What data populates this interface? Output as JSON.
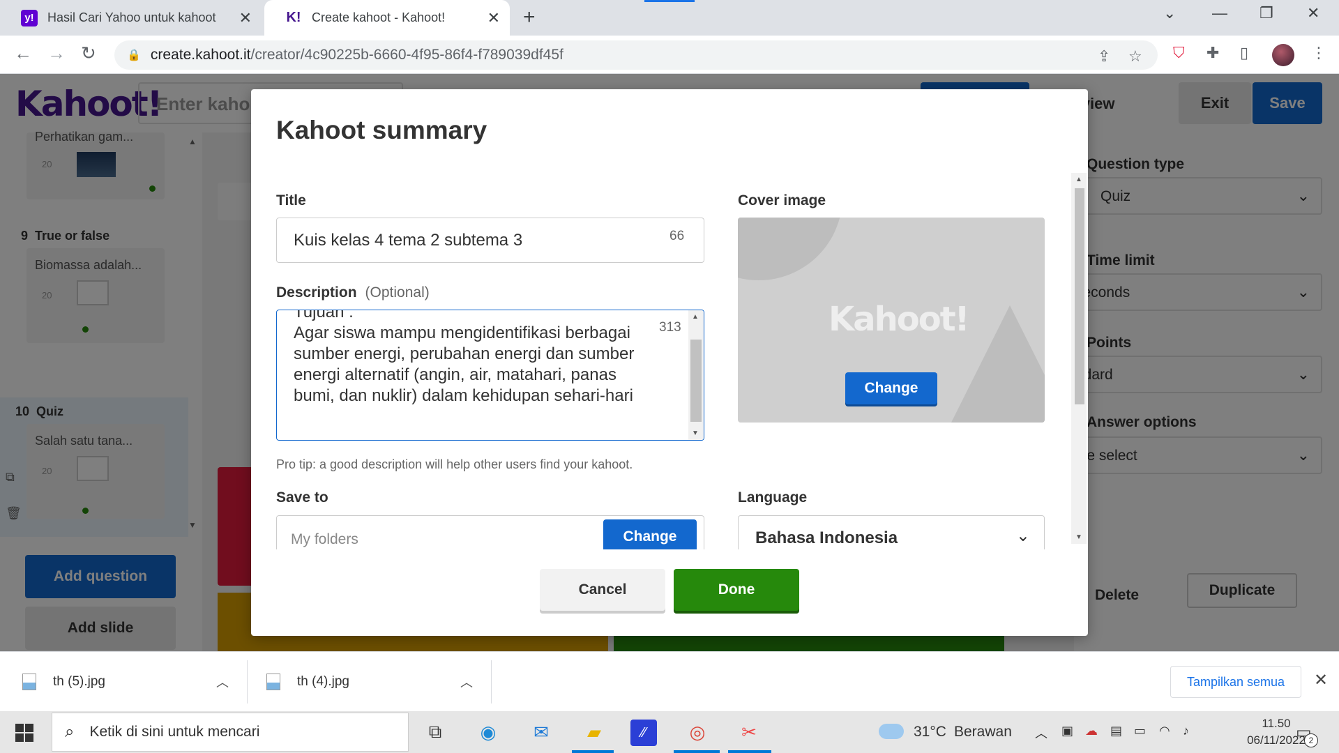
{
  "browser": {
    "tabs": [
      {
        "title": "Hasil Cari Yahoo untuk kahoot",
        "favicon": "y!"
      },
      {
        "title": "Create kahoot - Kahoot!",
        "favicon": "K!"
      }
    ],
    "new_tab": "+",
    "url_domain": "create.kahoot.it",
    "url_path": "/creator/4c90225b-6660-4f95-86f4-f789039df45f"
  },
  "app": {
    "logo": "Kahoot!",
    "title_placeholder": "Enter kaho",
    "preview_label": "review",
    "exit_label": "Exit",
    "save_label": "Save",
    "slides": [
      {
        "title": "Perhatikan gam...",
        "num": "20"
      },
      {
        "label_num": "9",
        "label_type": "True or false",
        "title": "Biomassa adalah...",
        "num": "20"
      },
      {
        "label_num": "10",
        "label_type": "Quiz",
        "title": "Salah satu tana...",
        "num": "20"
      }
    ],
    "add_question": "Add question",
    "add_slide": "Add slide",
    "right_panel": {
      "question_type_label": "Question type",
      "question_type_value": "Quiz",
      "time_limit_label": "Time limit",
      "time_limit_value": "seconds",
      "points_label": "Points",
      "points_value": "ndard",
      "answer_options_label": "Answer options",
      "answer_options_value": "gle select",
      "delete_label": "Delete",
      "duplicate_label": "Duplicate"
    }
  },
  "modal": {
    "title": "Kahoot summary",
    "title_label": "Title",
    "title_value": "Kuis kelas 4 tema 2 subtema 3",
    "title_count": "66",
    "description_label": "Description",
    "description_optional": "(Optional)",
    "description_value": "Tujuan :\nAgar siswa mampu mengidentifikasi berbagai sumber energi, perubahan energi dan sumber energi alternatif (angin, air, matahari, panas bumi, dan nuklir) dalam kehidupan sehari-hari",
    "description_count": "313",
    "pro_tip": "Pro tip: a good description will help other users find your kahoot.",
    "cover_label": "Cover image",
    "cover_logo": "Kahoot!",
    "cover_change": "Change",
    "save_to_label": "Save to",
    "save_to_value": "My folders",
    "save_to_change": "Change",
    "language_label": "Language",
    "language_value": "Bahasa Indonesia",
    "cancel_label": "Cancel",
    "done_label": "Done"
  },
  "downloads": {
    "items": [
      "th (5).jpg",
      "th (4).jpg"
    ],
    "show_all": "Tampilkan semua"
  },
  "taskbar": {
    "search_placeholder": "Ketik di sini untuk mencari",
    "weather_temp": "31°C",
    "weather_desc": "Berawan",
    "time": "11.50",
    "date": "06/11/2022",
    "notification_count": "2"
  }
}
